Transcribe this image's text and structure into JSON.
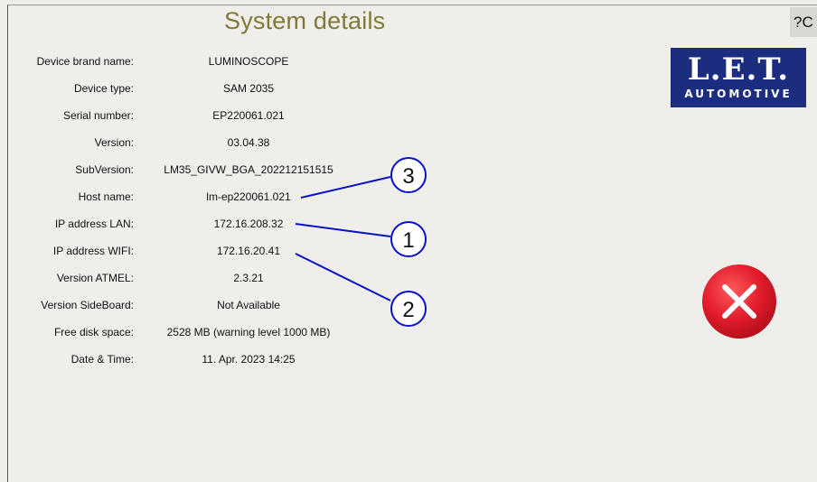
{
  "header": {
    "title": "System details",
    "help_label": "?C"
  },
  "logo": {
    "main": "L.E.T.",
    "sub": "AUTOMOTIVE"
  },
  "details": [
    {
      "label": "Device brand name:",
      "value": "LUMINOSCOPE"
    },
    {
      "label": "Device type:",
      "value": "SAM 2035"
    },
    {
      "label": "Serial number:",
      "value": "EP220061.021"
    },
    {
      "label": "Version:",
      "value": "03.04.38"
    },
    {
      "label": "SubVersion:",
      "value": "LM35_GIVW_BGA_202212151515"
    },
    {
      "label": "Host name:",
      "value": "lm-ep220061.021"
    },
    {
      "label": "IP address LAN:",
      "value": "172.16.208.32"
    },
    {
      "label": "IP address WIFI:",
      "value": "172.16.20.41"
    },
    {
      "label": "Version ATMEL:",
      "value": "2.3.21"
    },
    {
      "label": "Version SideBoard:",
      "value": "Not Available"
    },
    {
      "label": "Free disk space:",
      "value": "2528 MB (warning level 1000 MB)"
    },
    {
      "label": "Date & Time:",
      "value": "11. Apr. 2023 14:25"
    }
  ],
  "callouts": [
    "3",
    "1",
    "2"
  ],
  "colors": {
    "title": "#807a36",
    "logo_bg": "#1c2d80",
    "close_red": "#e21c2c",
    "callout_line": "#0a12c8"
  },
  "icons": {
    "close": "close-x-icon"
  }
}
